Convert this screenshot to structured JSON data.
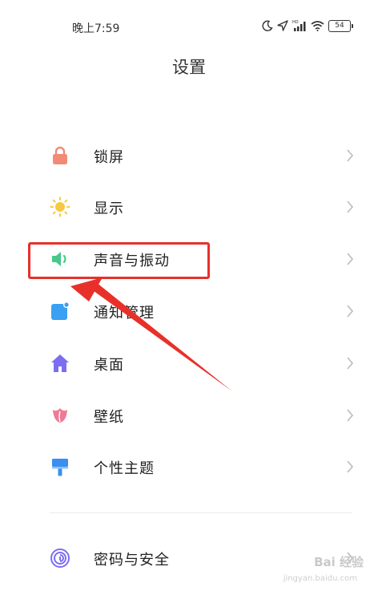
{
  "status_bar": {
    "time": "晚上7:59",
    "battery_level": "54",
    "icons": [
      "moon-icon",
      "location-icon",
      "hd-signal-icon",
      "wifi-icon",
      "battery-icon"
    ]
  },
  "page": {
    "title": "设置"
  },
  "menu": [
    {
      "label": "锁屏",
      "icon": "lock-icon",
      "icon_color": "#f28b76"
    },
    {
      "label": "显示",
      "icon": "sun-icon",
      "icon_color": "#f7c843"
    },
    {
      "label": "声音与振动",
      "icon": "speaker-icon",
      "icon_color": "#46c98a",
      "highlighted": true
    },
    {
      "label": "通知管理",
      "icon": "notification-icon",
      "icon_color": "#3aa0f2"
    },
    {
      "label": "桌面",
      "icon": "home-icon",
      "icon_color": "#7b6ef0"
    },
    {
      "label": "壁纸",
      "icon": "tulip-icon",
      "icon_color": "#f07a96"
    },
    {
      "label": "个性主题",
      "icon": "paintbrush-icon",
      "icon_color": "#3a8ff0"
    },
    {
      "label": "密码与安全",
      "icon": "fingerprint-icon",
      "icon_color": "#7b6ef0"
    }
  ],
  "annotation": {
    "color": "#e8302a",
    "target": "声音与振动"
  },
  "watermark": {
    "text": "Bai 经验",
    "sub": "jingyan.baidu.com"
  }
}
